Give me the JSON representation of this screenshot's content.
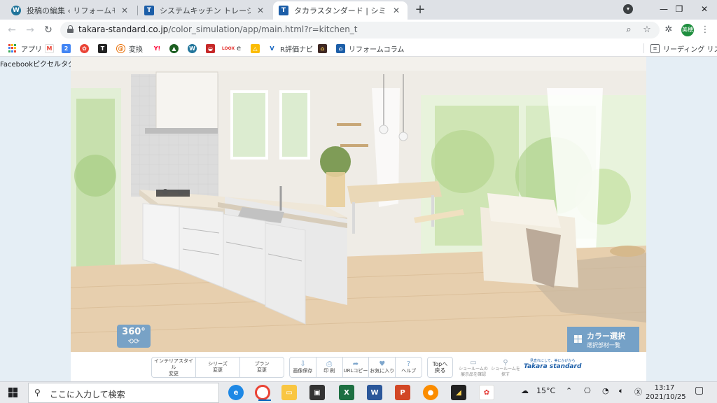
{
  "browser": {
    "tabs": [
      {
        "title": "投稿の編集 ‹ リフォームモリハウス | 君",
        "favicon": "wordpress-icon",
        "active": false
      },
      {
        "title": "システムキッチン トレーシア | タカラスタ",
        "favicon": "takara-icon",
        "active": false
      },
      {
        "title": "タカラスタンダード | シミュレーション",
        "favicon": "takara-icon",
        "active": true
      }
    ],
    "url_host": "takara-standard.co.jp",
    "url_path": "/color_simulation/app/main.html?r=kitchen_t",
    "profile_initials": "美穂",
    "bookmarks": [
      {
        "label": "アプリ"
      },
      {
        "label": "変換"
      },
      {
        "label": "e"
      },
      {
        "label": "R評価ナビ"
      },
      {
        "label": "リフォームコラム"
      }
    ],
    "reading_list": "リーディング リスト"
  },
  "page": {
    "fb_pixel_text": "Facebookピクセルタグ",
    "badge_360": "360°",
    "color_select": {
      "title": "カラー選択",
      "subtitle": "選択部材一覧"
    },
    "controls": {
      "style_group": [
        {
          "label": "インテリアスタイル",
          "sub": "変更"
        },
        {
          "label": "シリーズ",
          "sub": "変更"
        },
        {
          "label": "プラン",
          "sub": "変更"
        }
      ],
      "action_group": [
        {
          "label": "画像保存",
          "icon": "download-icon"
        },
        {
          "label": "印 刷",
          "icon": "print-icon"
        },
        {
          "label": "URLコピー",
          "icon": "share-icon"
        },
        {
          "label": "お気に入り",
          "icon": "heart-icon"
        },
        {
          "label": "ヘルプ",
          "icon": "help-icon"
        }
      ],
      "top_back": {
        "line1": "Topへ",
        "line2": "戻る"
      },
      "showroom_check": {
        "line1": "ショールームの",
        "line2": "展示品を確認"
      },
      "showroom_find": {
        "line1": "ショールームを",
        "line2": "探す"
      },
      "brand_tagline": "見直れにして、美にかげから",
      "brand_name": "Takara standard"
    }
  },
  "taskbar": {
    "search_placeholder": "ここに入力して検索",
    "weather": "15°C",
    "time": "13:17",
    "date": "2021/10/25"
  },
  "colors": {
    "accent_button": "#6f9fc9",
    "chrome_tab_strip": "#dee1e6",
    "takara_blue": "#1c5ea8"
  }
}
